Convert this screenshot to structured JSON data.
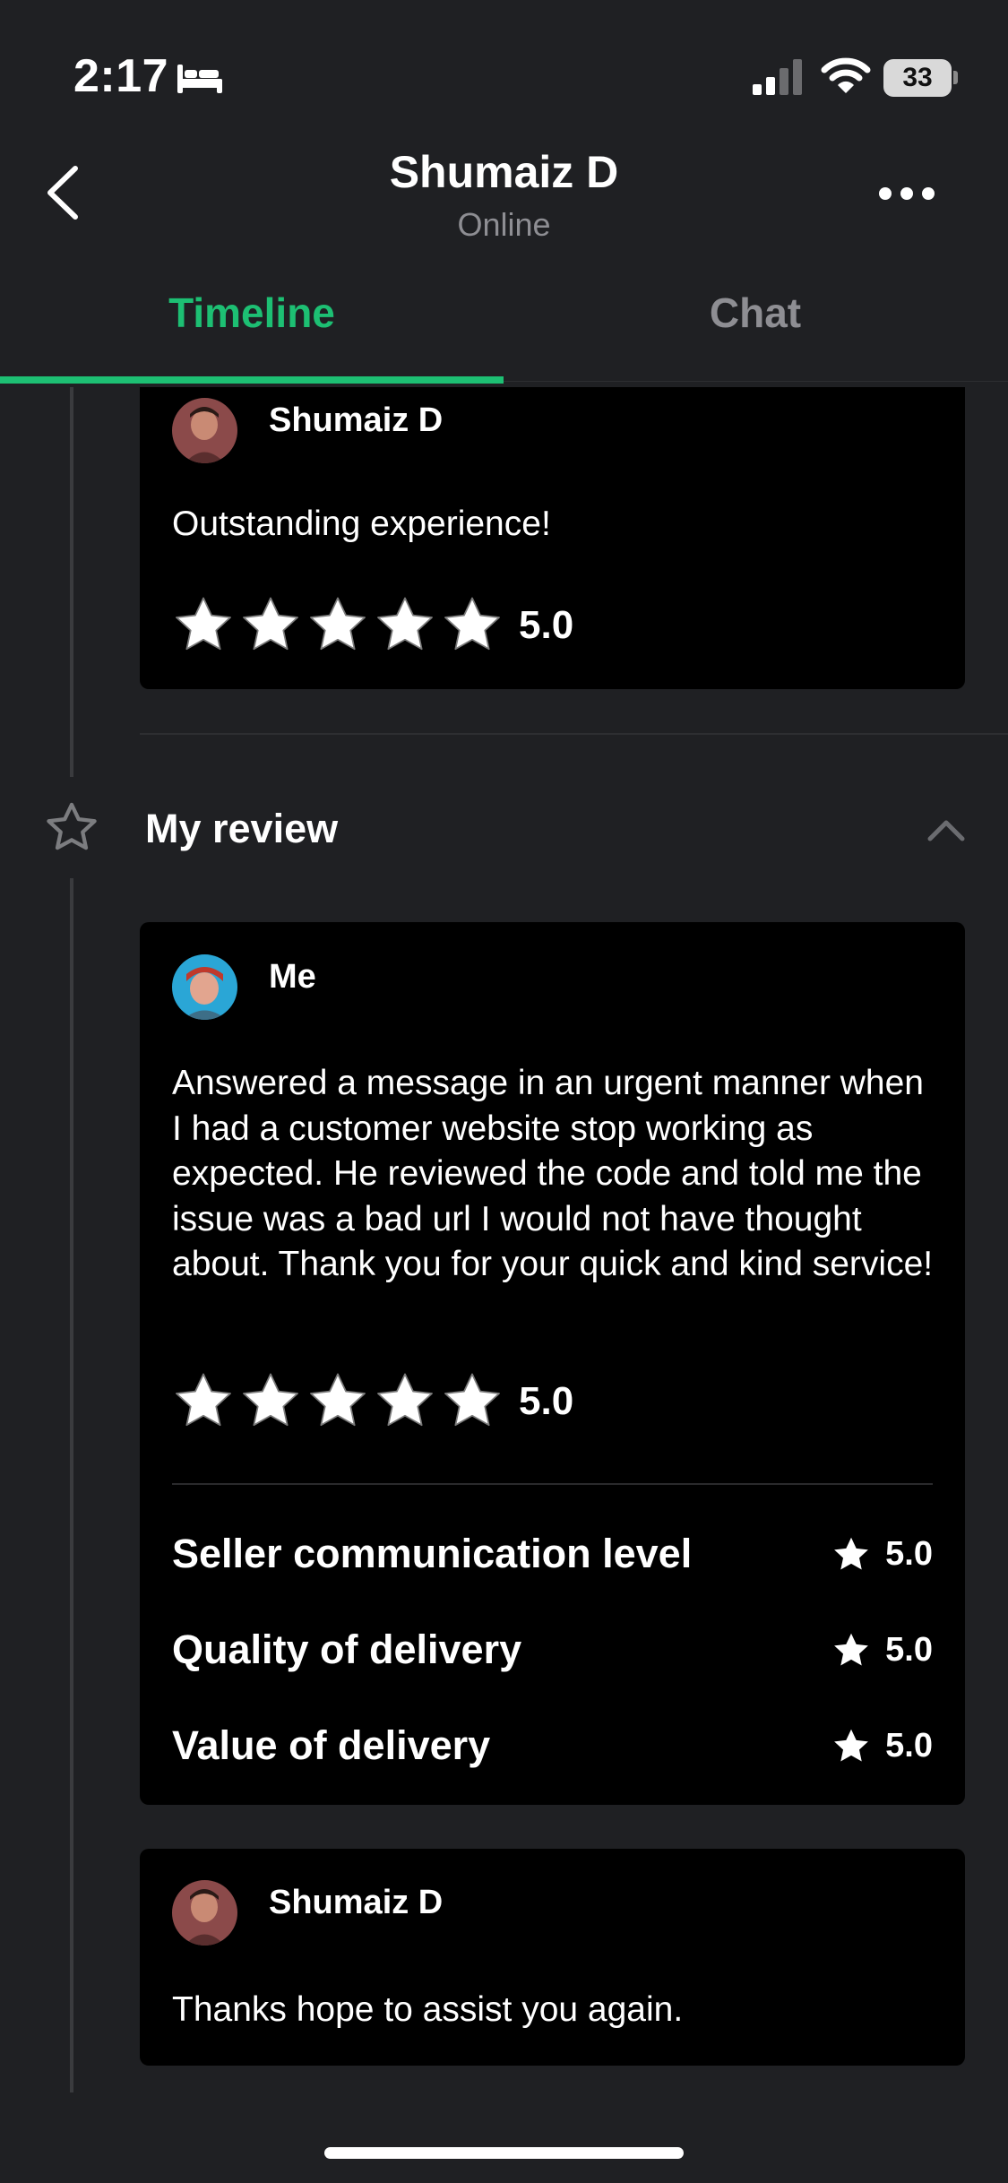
{
  "status_bar": {
    "time": "2:17",
    "battery": "33",
    "icons": [
      "bed-icon",
      "cellular-signal-icon",
      "wifi-icon",
      "battery-icon"
    ]
  },
  "header": {
    "title": "Shumaiz D",
    "subtitle": "Online",
    "icons": [
      "chevron-left-icon",
      "more-horizontal-icon"
    ]
  },
  "tabs": [
    {
      "label": "Timeline",
      "active": true
    },
    {
      "label": "Chat",
      "active": false
    }
  ],
  "colors": {
    "accent": "#1dbf73",
    "background": "#1f2023",
    "card": "#000000",
    "muted": "#8e8e93"
  },
  "seller_review": {
    "author": "Shumaiz D",
    "text": "Outstanding experience!",
    "stars": 5,
    "rating": "5.0"
  },
  "my_review_section": {
    "title": "My review",
    "collapse_icon": "chevron-up-icon",
    "review": {
      "author": "Me",
      "text": "Answered a message in an urgent manner when I had a customer website stop working as expected. He reviewed the code and told me the issue was a bad url I would not have thought about. Thank you for your quick and kind service!",
      "stars": 5,
      "rating": "5.0",
      "criteria": [
        {
          "label": "Seller communication level",
          "value": "5.0"
        },
        {
          "label": "Quality of delivery",
          "value": "5.0"
        },
        {
          "label": "Value of delivery",
          "value": "5.0"
        }
      ]
    },
    "reply": {
      "author": "Shumaiz D",
      "text": "Thanks hope to assist you again."
    }
  }
}
